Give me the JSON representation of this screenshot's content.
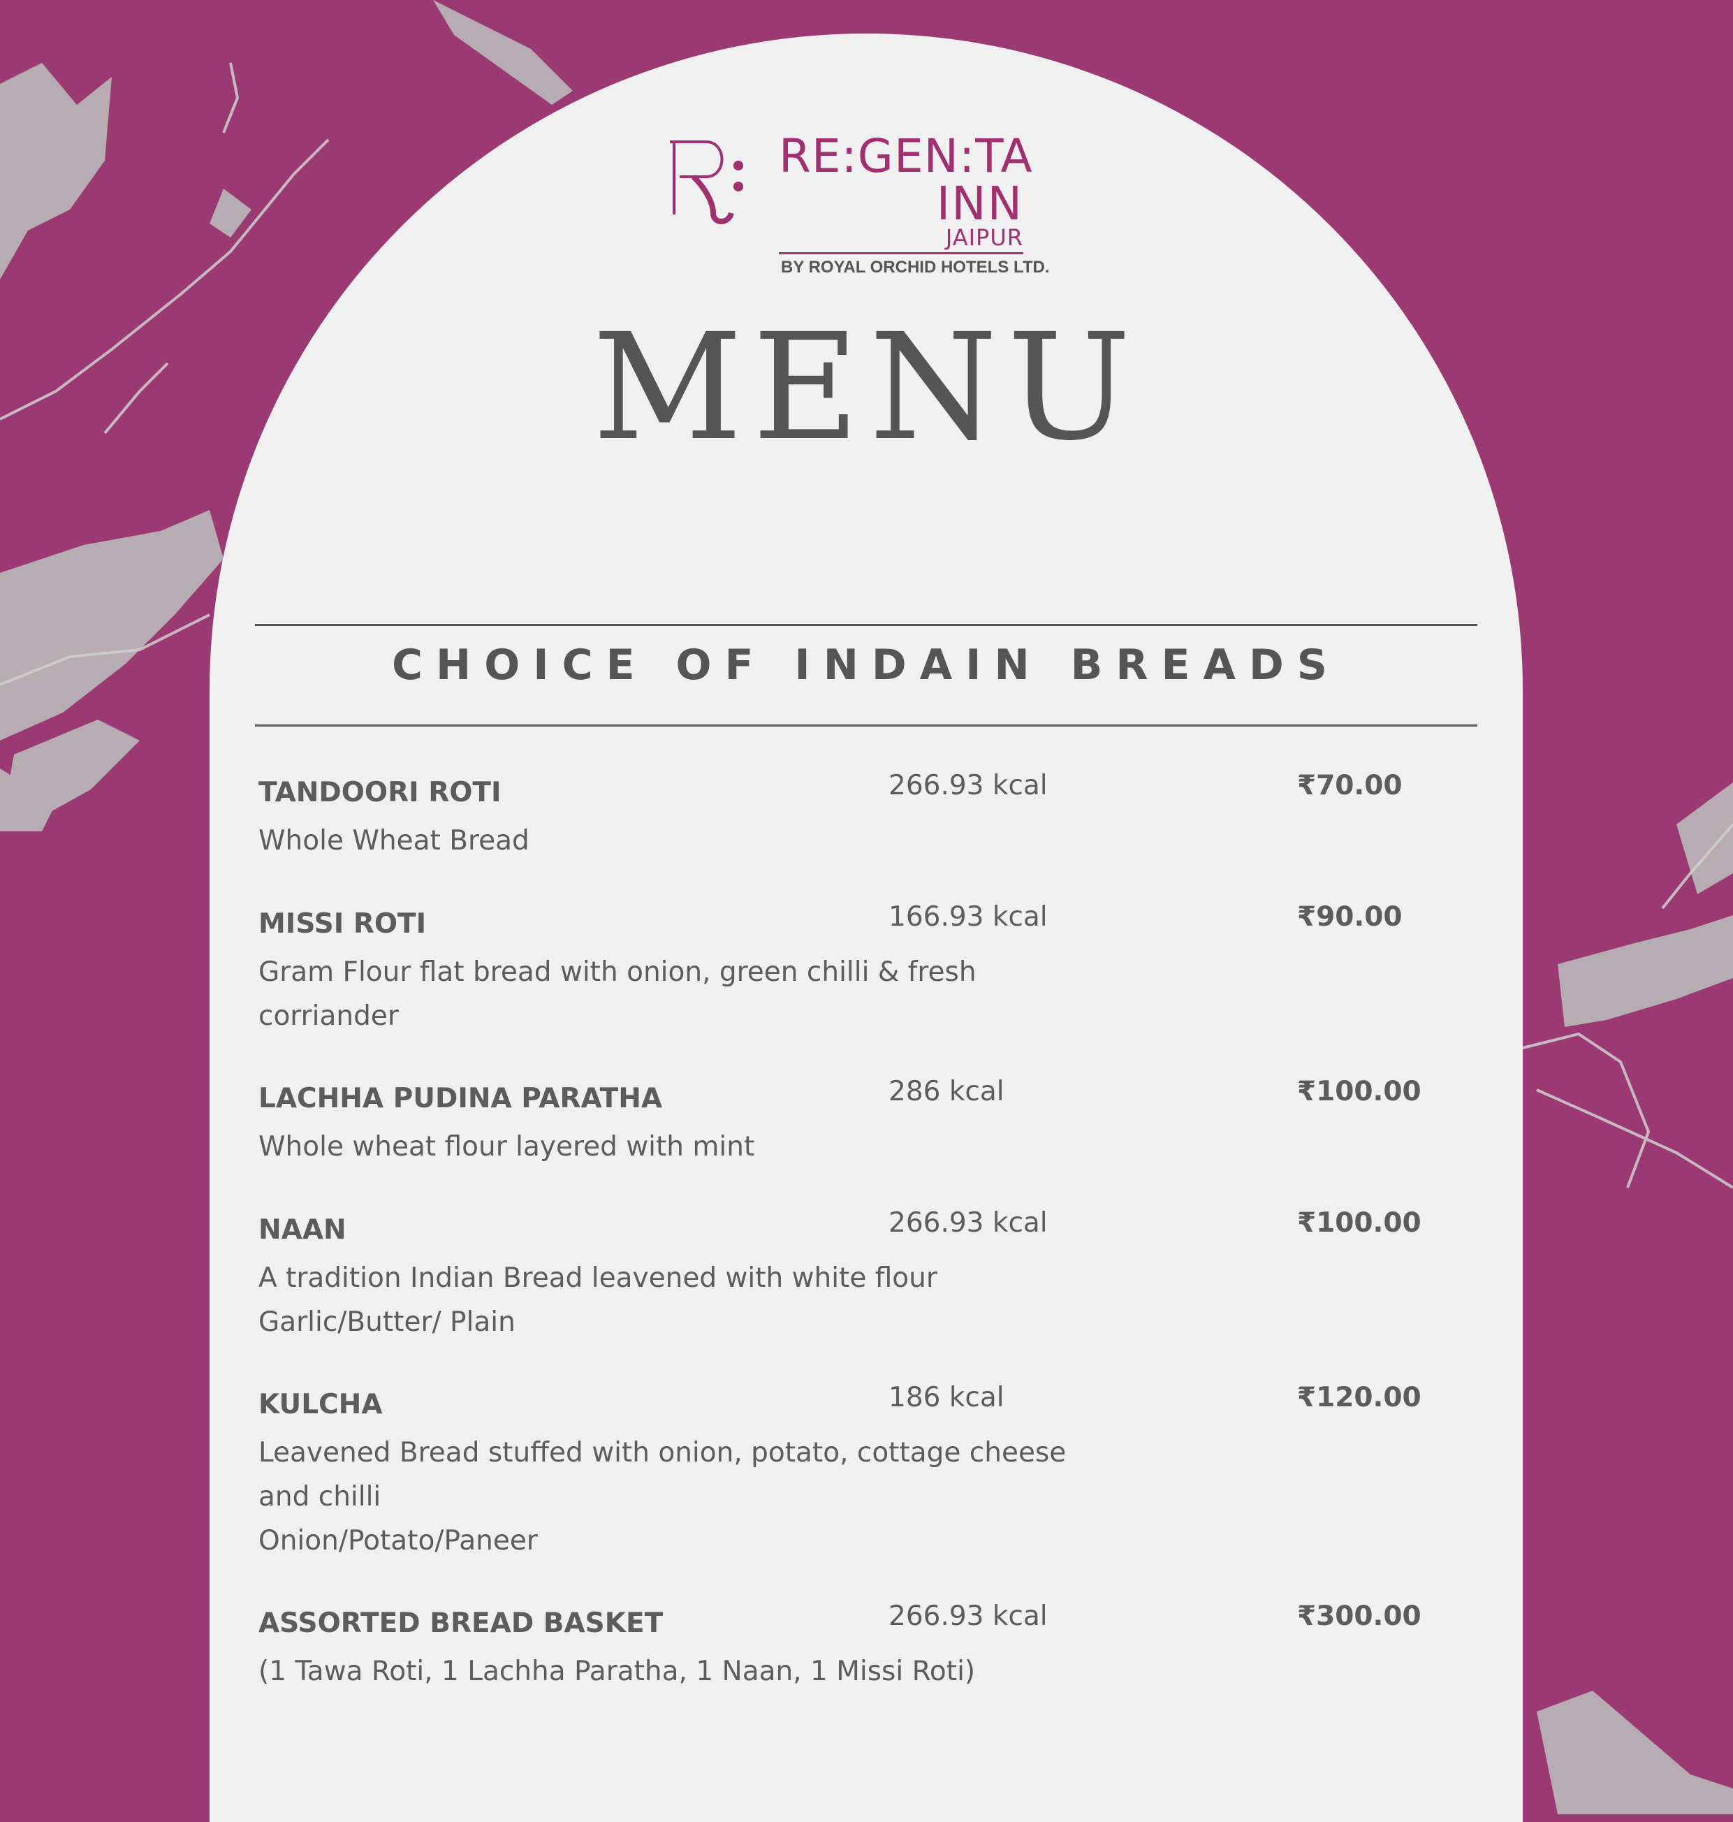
{
  "colors": {
    "background": "#9b3a72",
    "panel": "#f0f0f0",
    "brand": "#a0306f",
    "text": "#555555"
  },
  "logo": {
    "mark_icon": "regenta-r-monogram",
    "line1": "RE:GEN:TA",
    "line2": "INN",
    "line3": "JAIPUR",
    "tagline": "BY ROYAL ORCHID HOTELS LTD."
  },
  "title": "MENU",
  "section": {
    "heading": "CHOICE OF INDAIN BREADS"
  },
  "items": [
    {
      "name": "TANDOORI ROTI",
      "kcal": "266.93 kcal",
      "price": "₹70.00",
      "desc": [
        "Whole Wheat Bread"
      ]
    },
    {
      "name": "MISSI ROTI",
      "kcal": "166.93 kcal",
      "price": "₹90.00",
      "desc": [
        "Gram Flour flat bread with onion, green chilli & fresh",
        "corriander"
      ]
    },
    {
      "name": "LACHHA PUDINA PARATHA",
      "kcal": "286 kcal",
      "price": "₹100.00",
      "desc": [
        "Whole wheat flour layered with mint"
      ]
    },
    {
      "name": "NAAN",
      "kcal": "266.93 kcal",
      "price": "₹100.00",
      "desc": [
        "A tradition Indian Bread leavened with white flour",
        "Garlic/Butter/ Plain"
      ]
    },
    {
      "name": "KULCHA",
      "kcal": "186 kcal",
      "price": "₹120.00",
      "desc": [
        "Leavened Bread stuffed with onion, potato, cottage cheese",
        "and chilli",
        "Onion/Potato/Paneer"
      ]
    },
    {
      "name": "ASSORTED BREAD BASKET",
      "kcal": "266.93 kcal",
      "price": "₹300.00",
      "desc": [
        "(1 Tawa Roti, 1 Lachha Paratha, 1 Naan, 1 Missi Roti)"
      ]
    }
  ]
}
